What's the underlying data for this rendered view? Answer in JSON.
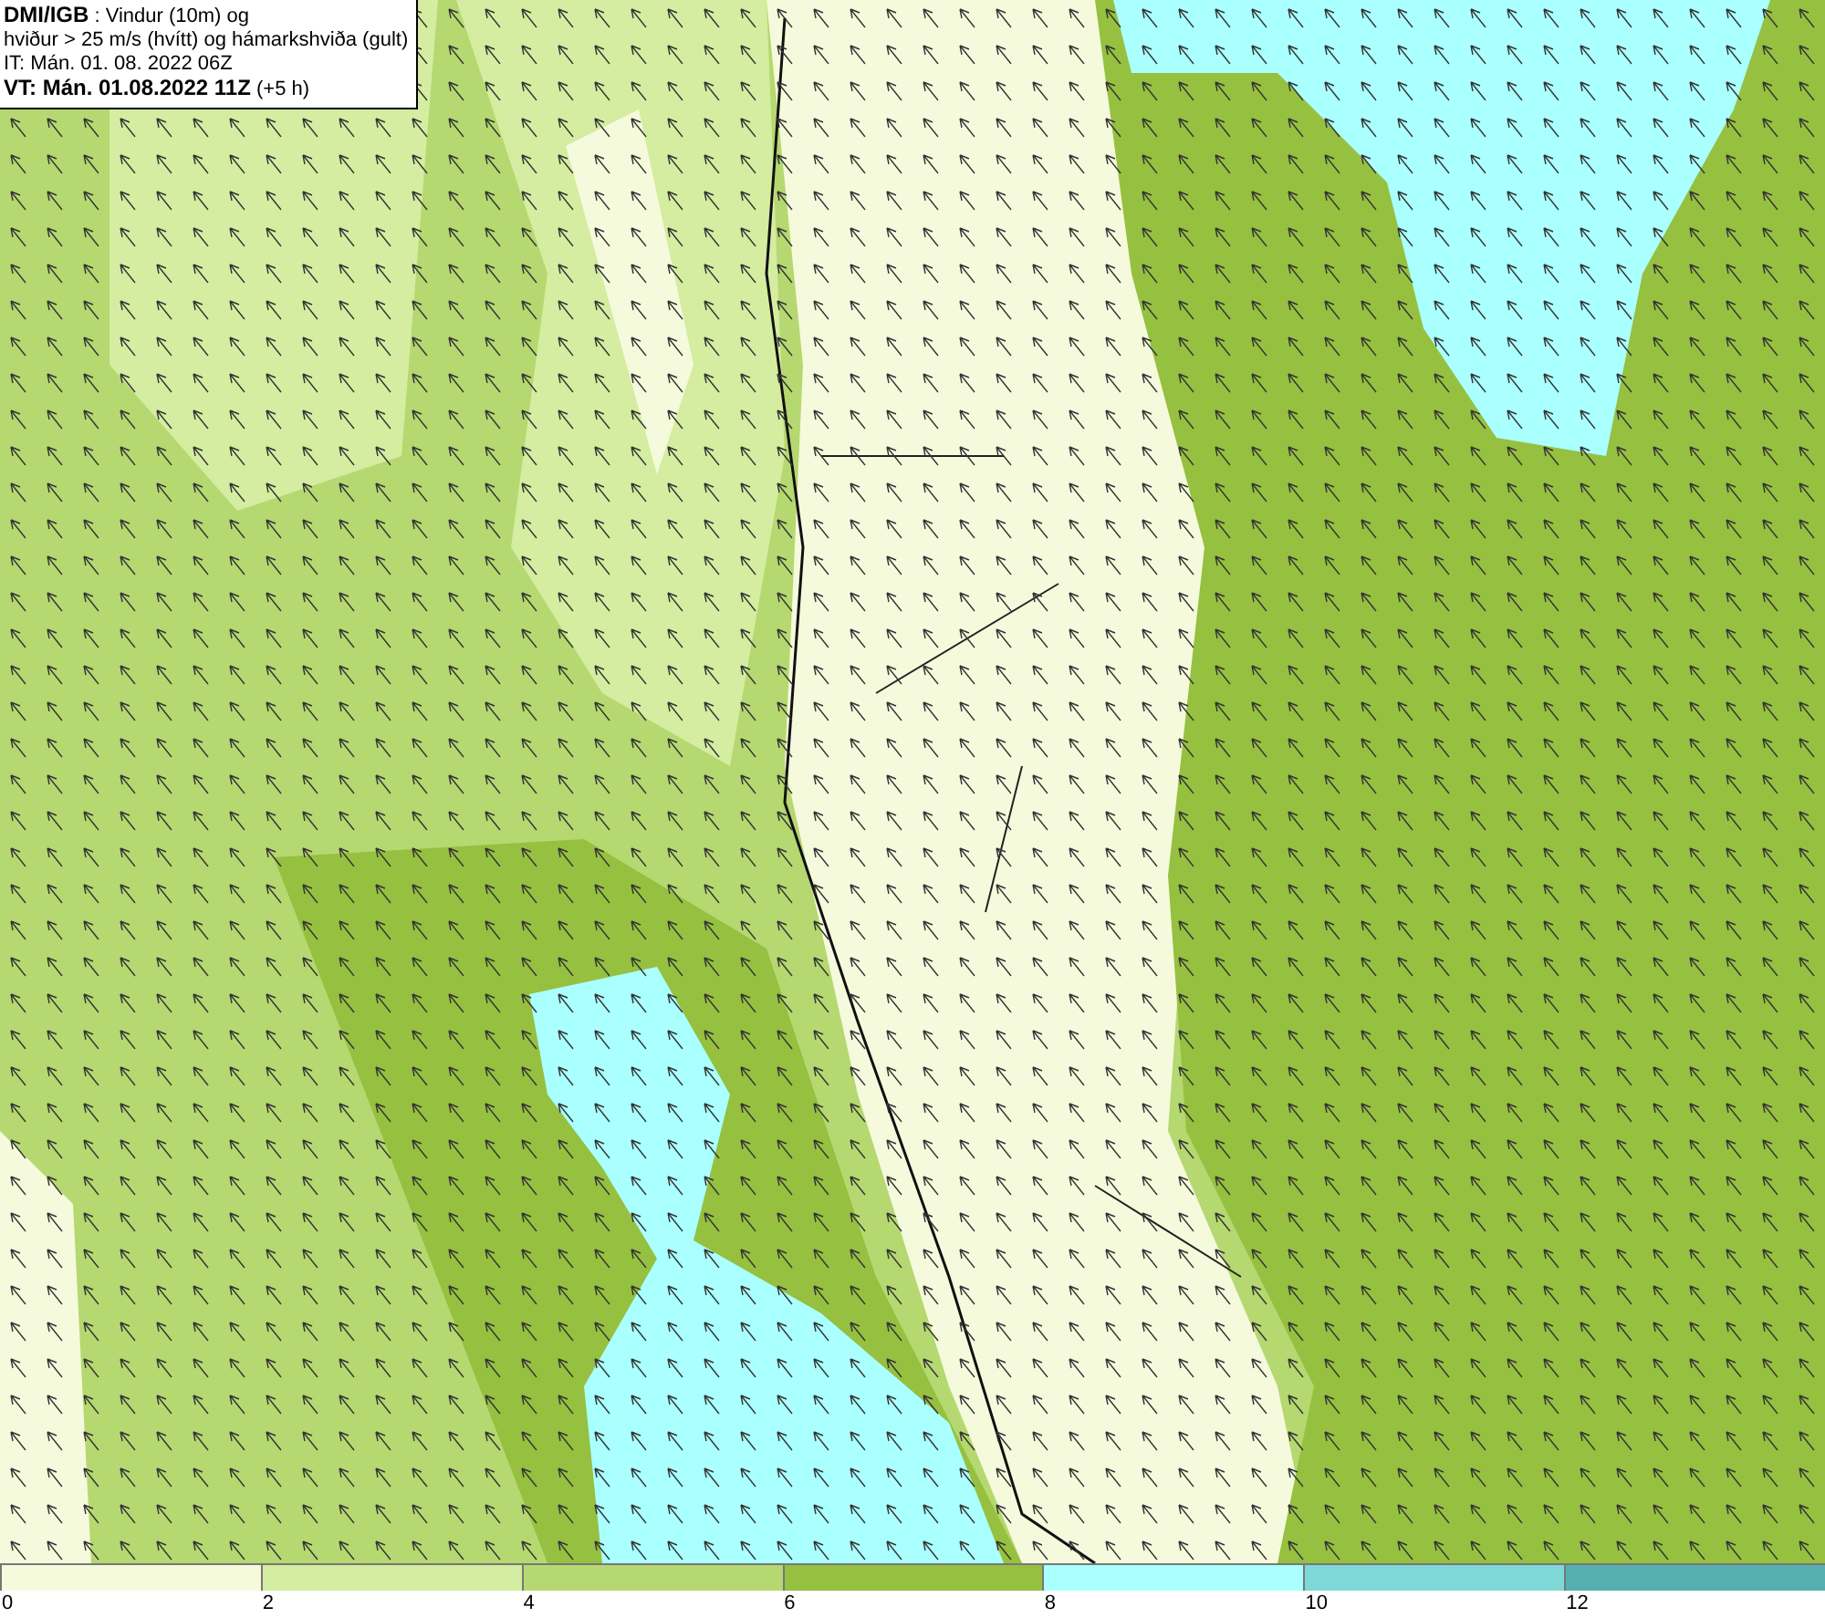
{
  "info_box": {
    "lines": [
      "**DMI/IGB** : Vindur (10m) og",
      "hviður > 25 m/s (hvítt) og hámarkshviða (gult)",
      "IT: Mán. 01. 08. 2022 06Z",
      "**VT: Mán. 01.08.2022 11Z** (+5 h)"
    ]
  },
  "legend": {
    "bins": [
      {
        "color": "#f5fadc"
      },
      {
        "color": "#d4eda0"
      },
      {
        "color": "#b5d870"
      },
      {
        "color": "#96c040"
      },
      {
        "color": "#aaffff"
      },
      {
        "color": "#7fd8d8"
      },
      {
        "color": "#55b0b0"
      }
    ],
    "labels": [
      "0",
      "2",
      "4",
      "6",
      "8",
      "10",
      "12"
    ]
  }
}
